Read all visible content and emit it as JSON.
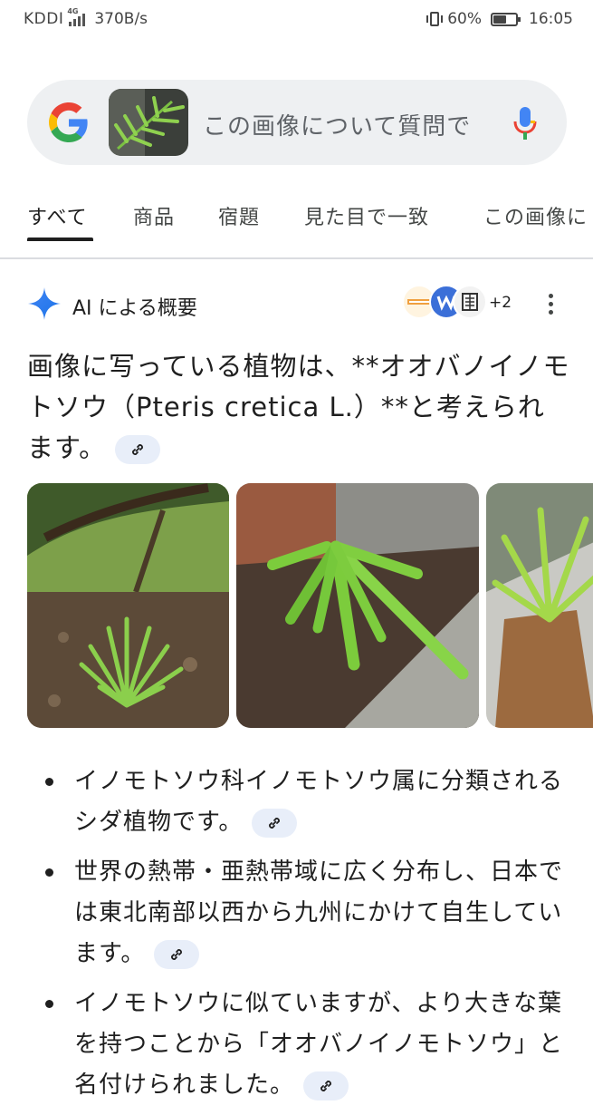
{
  "status_bar": {
    "carrier": "KDDI",
    "network": "4G",
    "speed": "370B/s",
    "battery": "60%",
    "battery_level": 0.6,
    "time": "16:05"
  },
  "search": {
    "query_text": "この画像について質問で",
    "logo": "google-g-logo",
    "mic_icon": "mic-icon"
  },
  "tabs": [
    {
      "label": "すべて",
      "active": true
    },
    {
      "label": "商品",
      "active": false
    },
    {
      "label": "宿題",
      "active": false
    },
    {
      "label": "見た目で一致",
      "active": false
    },
    {
      "label": "この画像に",
      "active": false
    }
  ],
  "ai_overview": {
    "title": "AI による概要",
    "sources_more": "+2",
    "headline": "画像に写っている植物は、**オオバノイノモトソウ（Pteris cretica L.）**と考えられます。",
    "bullets": [
      "イノモトソウ科イノモトソウ属に分類されるシダ植物です。",
      "世界の熱帯・亜熱帯域に広く分布し、日本では東北南部以西から九州にかけて自生しています。",
      "イノモトソウに似ていますが、より大きな葉を持つことから「オオバノイノモトソウ」と名付けられました。"
    ]
  },
  "colors": {
    "accent": "#1a73e8",
    "link_chip_bg": "#e8eef9",
    "search_bg": "#eef0f2",
    "text": "#1f1f1f"
  }
}
